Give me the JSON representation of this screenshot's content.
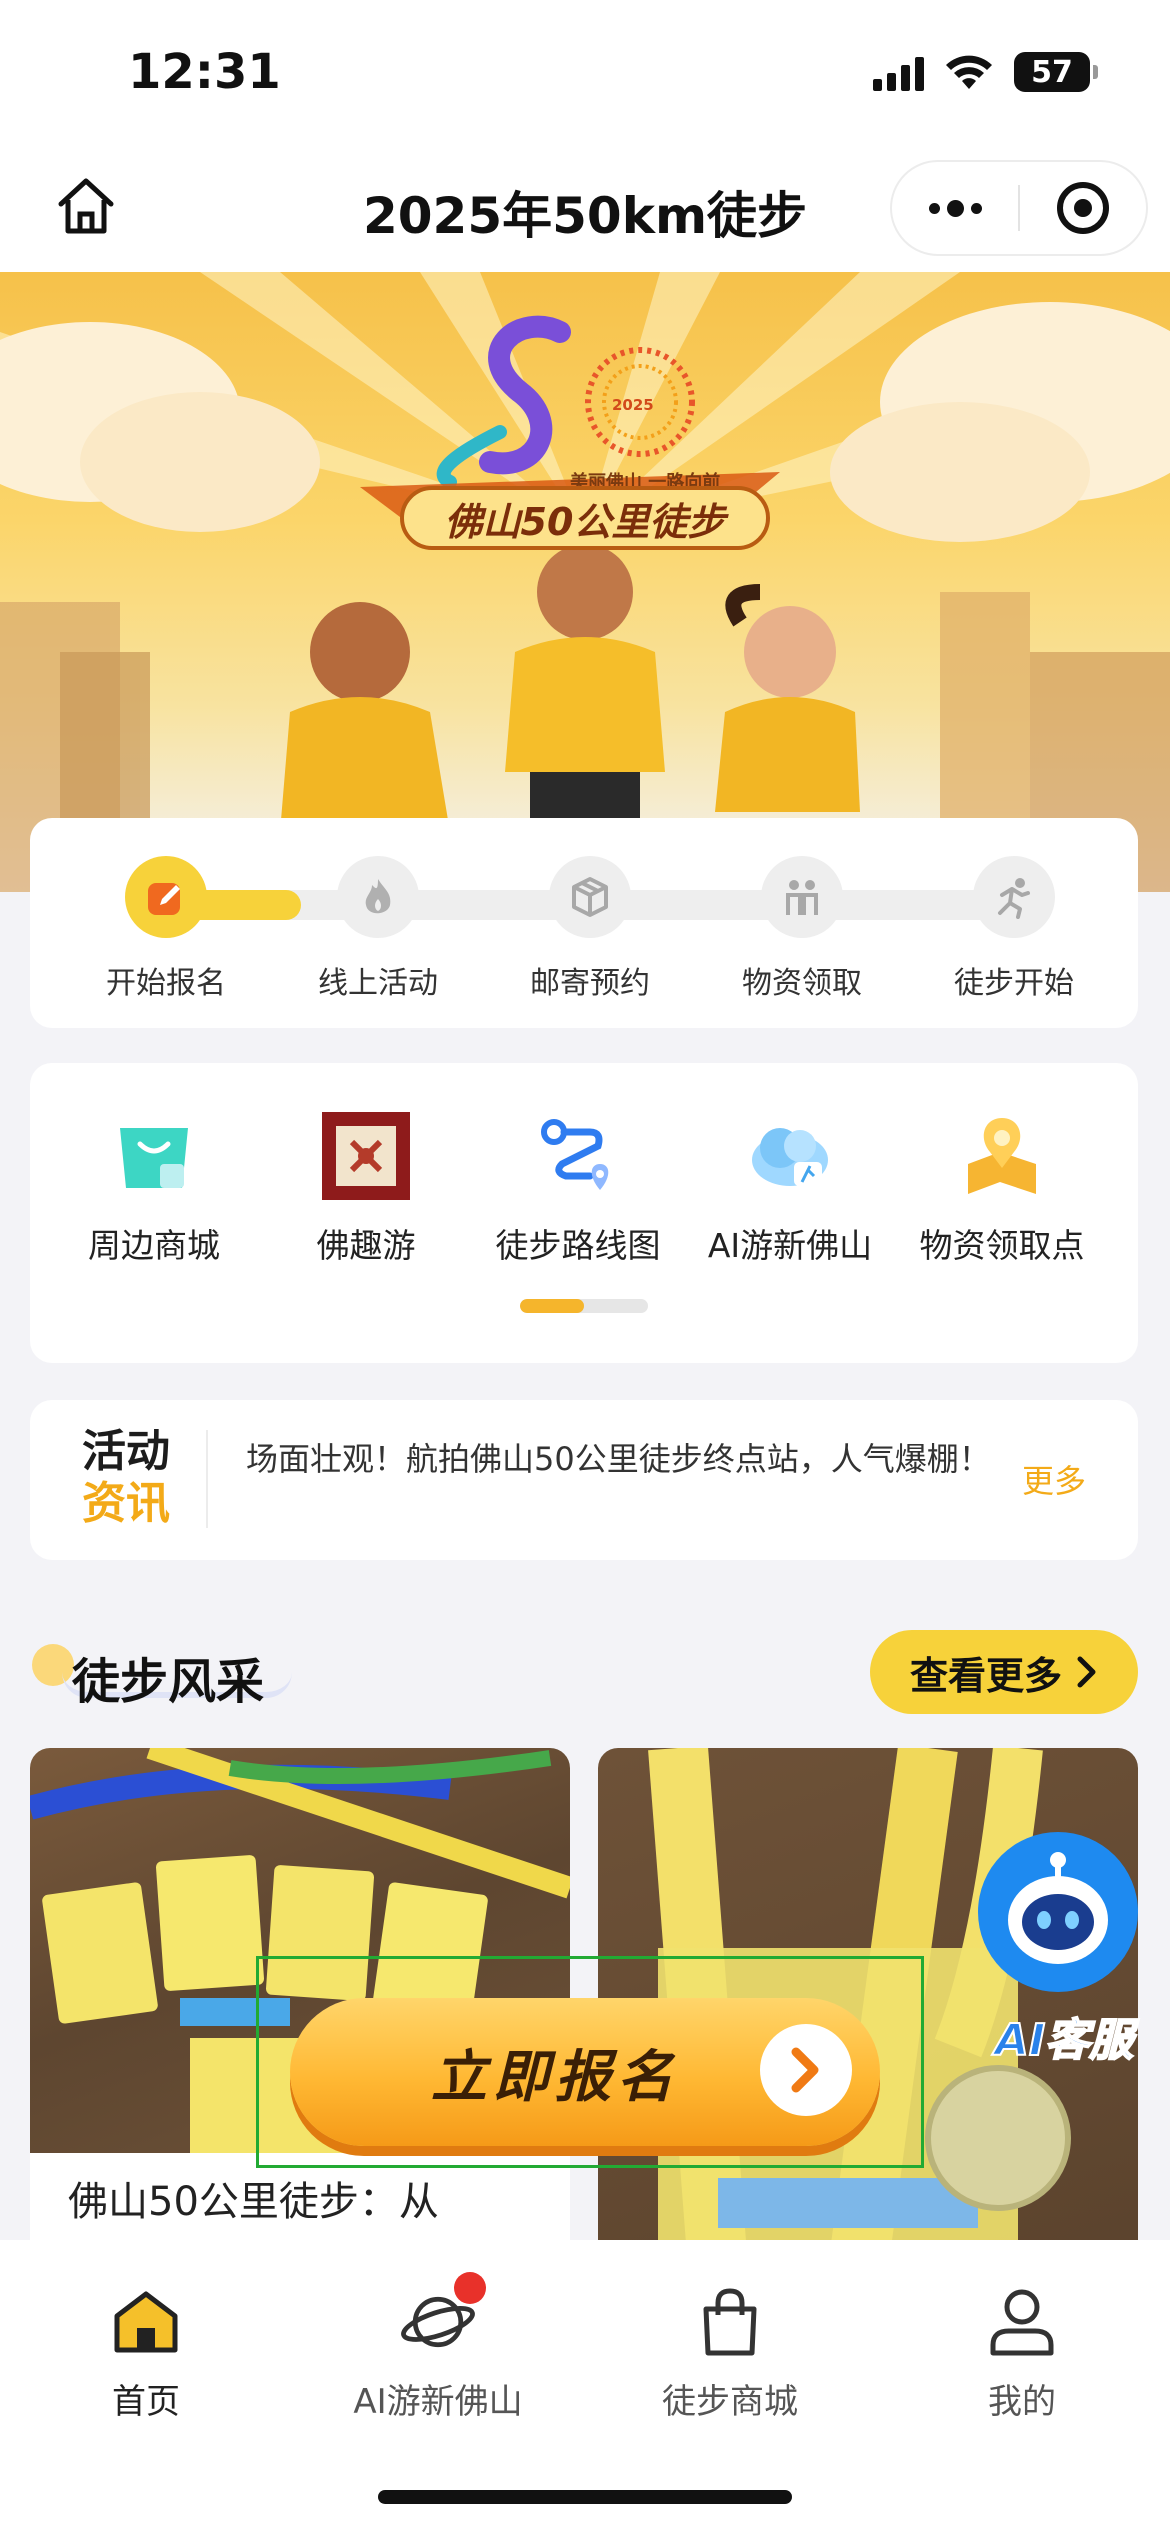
{
  "status_bar": {
    "time": "12:31",
    "battery": "57"
  },
  "nav": {
    "title": "2025年50km徒步"
  },
  "banner": {
    "slogan": "美丽佛山 一路向前",
    "title": "佛山50公里徒步",
    "year": "2025"
  },
  "steps": [
    {
      "label": "开始报名",
      "icon": "pencil-icon",
      "active": true
    },
    {
      "label": "线上活动",
      "icon": "flame-icon",
      "active": false
    },
    {
      "label": "邮寄预约",
      "icon": "package-icon",
      "active": false
    },
    {
      "label": "物资领取",
      "icon": "people-icon",
      "active": false
    },
    {
      "label": "徒步开始",
      "icon": "runner-icon",
      "active": false
    }
  ],
  "steps_progress": 0.16,
  "shortcuts": [
    {
      "label": "周边商城",
      "icon": "shopping-bag-icon"
    },
    {
      "label": "佛趣游",
      "icon": "foquyou-logo-icon"
    },
    {
      "label": "徒步路线图",
      "icon": "route-icon"
    },
    {
      "label": "AI游新佛山",
      "icon": "ai-cloud-icon"
    },
    {
      "label": "物资领取点",
      "icon": "map-pin-icon"
    }
  ],
  "news": {
    "tag_line1": "活动",
    "tag_line2": "资讯",
    "text": "场面壮观！航拍佛山50公里徒步终点站，人气爆棚！",
    "more": "更多"
  },
  "section": {
    "title": "徒步风采",
    "see_more": "查看更多"
  },
  "photos": [
    {
      "caption": "佛山50公里徒步：从"
    },
    {
      "caption": ""
    }
  ],
  "cta": {
    "label": "立即报名"
  },
  "ai_service": {
    "label": "AI客服"
  },
  "tabs": [
    {
      "label": "首页",
      "icon": "home-icon",
      "active": true
    },
    {
      "label": "AI游新佛山",
      "icon": "planet-icon",
      "badge": true
    },
    {
      "label": "徒步商城",
      "icon": "shopping-bag-icon"
    },
    {
      "label": "我的",
      "icon": "user-icon"
    }
  ],
  "colors": {
    "accent_yellow": "#f7d23a",
    "accent_orange": "#f3aa18",
    "background": "#f3f3f7",
    "badge_red": "#e8312a",
    "ai_blue": "#1e8af0"
  }
}
